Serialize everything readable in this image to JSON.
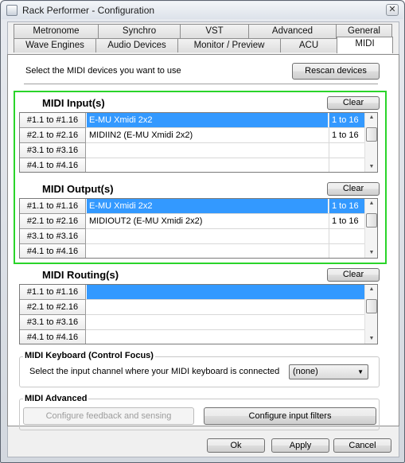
{
  "window": {
    "title": "Rack Performer - Configuration",
    "close_glyph": "✕"
  },
  "tabs_row1": [
    "Metronome",
    "Synchro",
    "VST",
    "Advanced",
    "General"
  ],
  "tabs_row2": [
    "Wave Engines",
    "Audio Devices",
    "Monitor / Preview",
    "ACU",
    "MIDI"
  ],
  "active_tab": "MIDI",
  "header": {
    "instruction": "Select the MIDI devices you want to use",
    "rescan_label": "Rescan devices"
  },
  "inputs": {
    "title": "MIDI Input(s)",
    "clear_label": "Clear",
    "rows": [
      {
        "channel": "#1.1 to #1.16",
        "device": "E-MU Xmidi 2x2",
        "range": "1 to 16",
        "selected": true
      },
      {
        "channel": "#2.1 to #2.16",
        "device": "MIDIIN2 (E-MU Xmidi 2x2)",
        "range": "1 to 16",
        "selected": false
      },
      {
        "channel": "#3.1 to #3.16",
        "device": "",
        "range": "",
        "selected": false
      },
      {
        "channel": "#4.1 to #4.16",
        "device": "",
        "range": "",
        "selected": false
      }
    ]
  },
  "outputs": {
    "title": "MIDI Output(s)",
    "clear_label": "Clear",
    "rows": [
      {
        "channel": "#1.1 to #1.16",
        "device": "E-MU Xmidi 2x2",
        "range": "1 to 16",
        "selected": true
      },
      {
        "channel": "#2.1 to #2.16",
        "device": "MIDIOUT2 (E-MU Xmidi 2x2)",
        "range": "1 to 16",
        "selected": false
      },
      {
        "channel": "#3.1 to #3.16",
        "device": "",
        "range": "",
        "selected": false
      },
      {
        "channel": "#4.1 to #4.16",
        "device": "",
        "range": "",
        "selected": false
      }
    ]
  },
  "routing": {
    "title": "MIDI Routing(s)",
    "clear_label": "Clear",
    "rows": [
      {
        "channel": "#1.1 to #1.16",
        "device": "",
        "range": "",
        "selected": true
      },
      {
        "channel": "#2.1 to #2.16",
        "device": "",
        "range": "",
        "selected": false
      },
      {
        "channel": "#3.1 to #3.16",
        "device": "",
        "range": "",
        "selected": false
      },
      {
        "channel": "#4.1 to #4.16",
        "device": "",
        "range": "",
        "selected": false
      }
    ]
  },
  "keyboard": {
    "title": "MIDI Keyboard (Control Focus)",
    "instruction": "Select the input channel where your MIDI keyboard is connected",
    "selected_value": "(none)"
  },
  "advanced": {
    "title": "MIDI Advanced",
    "feedback_label": "Configure feedback and sensing",
    "filters_label": "Configure input filters"
  },
  "footer": {
    "ok_label": "Ok",
    "apply_label": "Apply",
    "cancel_label": "Cancel"
  },
  "colors": {
    "selection": "#3399ff",
    "highlight_frame": "#2ad42a"
  }
}
